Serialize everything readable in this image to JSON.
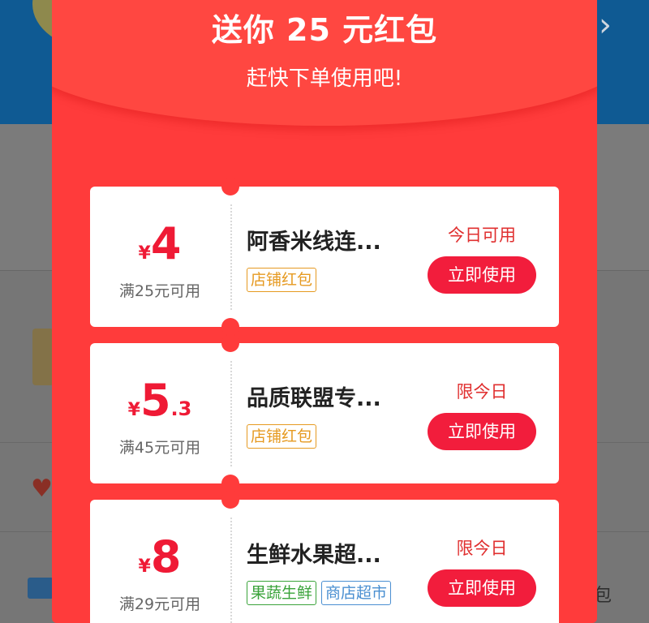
{
  "colors": {
    "popup_bg": "#ff3b3b",
    "accent": "#f21d3c",
    "tag_orange": "#e69a21",
    "tag_green": "#3aa33a",
    "tag_blue": "#4a8fd1"
  },
  "background": {
    "right_chevron_icon": "chevron-right-icon",
    "bottom_right_text": "包"
  },
  "popup": {
    "title": "送你 25 元红包",
    "subtitle": "赶快下单使用吧!",
    "coupons": [
      {
        "currency": "¥",
        "amount_int": "4",
        "amount_dec": "",
        "condition": "满25元可用",
        "shop": "阿香米线连...",
        "tags": [
          "店铺红包"
        ],
        "validity": "今日可用",
        "button": "立即使用"
      },
      {
        "currency": "¥",
        "amount_int": "5",
        "amount_dec": ".3",
        "condition": "满45元可用",
        "shop": "品质联盟专...",
        "tags": [
          "店铺红包"
        ],
        "validity": "限今日",
        "button": "立即使用"
      },
      {
        "currency": "¥",
        "amount_int": "8",
        "amount_dec": "",
        "condition": "满29元可用",
        "shop": "生鲜水果超...",
        "tags": [
          "果蔬生鲜",
          "商店超市"
        ],
        "validity": "限今日",
        "button": "立即使用"
      }
    ]
  }
}
